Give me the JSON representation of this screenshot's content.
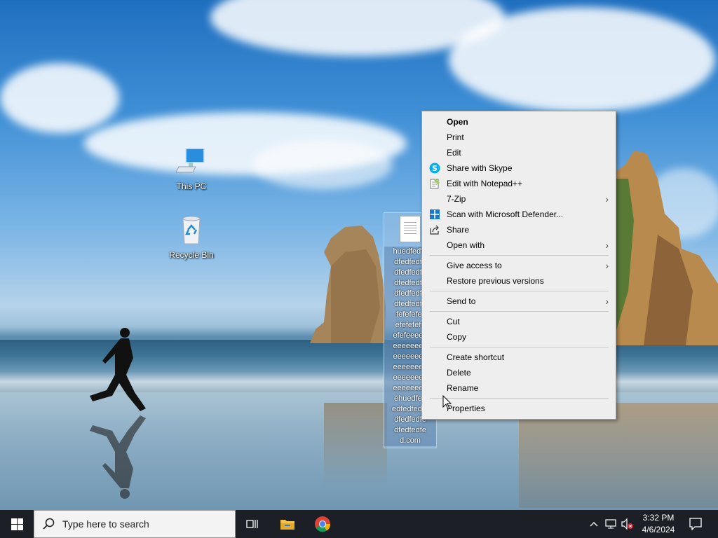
{
  "desktop": {
    "icons": [
      {
        "label": "This PC",
        "icon": "computer-icon"
      },
      {
        "label": "Recycle Bin",
        "icon": "recycle-bin-icon"
      }
    ],
    "selected_file": {
      "name": "huedfedfedfedfedfedfedfedfedfedfedfedfedfedfedfedfedfefefefefefefefefefefefeeeeeeeeeeeeeeeeeeeeeeeeeeeeeeeeeeeeeeeeeeehuedfedfedfedfedfedfedfedfedfedfedfed.com",
      "name_lines": [
        "huedfedfe",
        "dfedfedfe",
        "dfedfedfe",
        "dfedfedfe",
        "dfedfedfe",
        "dfedfedfe",
        "fefefefef",
        "efefefefe",
        "efefeeeee",
        "eeeeeeee",
        "eeeeeeee",
        "eeeeeeee",
        "eeeeeeee",
        "eeeeeeee",
        "ehuedfed",
        "edfedfedfe",
        "dfedfedfe",
        "dfedfedfe",
        "d.com"
      ],
      "icon": "text-document-icon"
    }
  },
  "context_menu": {
    "items": [
      {
        "label": "Open",
        "bold": true,
        "icon": "",
        "submenu": false
      },
      {
        "label": "Print",
        "icon": "",
        "submenu": false
      },
      {
        "label": "Edit",
        "icon": "",
        "submenu": false
      },
      {
        "label": "Share with Skype",
        "icon": "skype-icon",
        "submenu": false
      },
      {
        "label": "Edit with Notepad++",
        "icon": "notepad-plus-plus-icon",
        "submenu": false
      },
      {
        "label": "7-Zip",
        "icon": "",
        "submenu": true
      },
      {
        "label": "Scan with Microsoft Defender...",
        "icon": "defender-shield-icon",
        "submenu": false
      },
      {
        "label": "Share",
        "icon": "share-icon",
        "submenu": false
      },
      {
        "label": "Open with",
        "icon": "",
        "submenu": true
      },
      {
        "separator": true
      },
      {
        "label": "Give access to",
        "icon": "",
        "submenu": true
      },
      {
        "label": "Restore previous versions",
        "icon": "",
        "submenu": false
      },
      {
        "separator": true
      },
      {
        "label": "Send to",
        "icon": "",
        "submenu": true
      },
      {
        "separator": true
      },
      {
        "label": "Cut",
        "icon": "",
        "submenu": false
      },
      {
        "label": "Copy",
        "icon": "",
        "submenu": false
      },
      {
        "separator": true
      },
      {
        "label": "Create shortcut",
        "icon": "",
        "submenu": false
      },
      {
        "label": "Delete",
        "icon": "",
        "submenu": false
      },
      {
        "label": "Rename",
        "icon": "",
        "submenu": false
      },
      {
        "separator": true
      },
      {
        "label": "Properties",
        "icon": "",
        "submenu": false
      }
    ]
  },
  "taskbar": {
    "start_icon": "windows-logo-icon",
    "search_placeholder": "Type here to search",
    "pinned": [
      "task-view-icon",
      "file-explorer-icon",
      "chrome-icon"
    ],
    "tray": {
      "time": "3:32 PM",
      "date": "4/6/2024",
      "icons": [
        "show-hidden-icons-chevron",
        "network-icon",
        "volume-muted-icon",
        "notifications-icon"
      ]
    }
  },
  "colors": {
    "menu_bg": "#eeeeee",
    "taskbar_bg": "#1c1f26",
    "selection": "#9bbee1"
  }
}
